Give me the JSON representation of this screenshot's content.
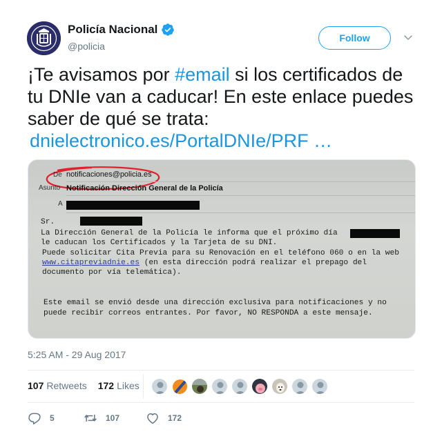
{
  "account": {
    "display_name": "Policía Nacional",
    "handle": "@policia",
    "verified_icon": "verified-badge-icon",
    "follow_label": "Follow"
  },
  "tweet": {
    "text_before": "¡Te avisamos por ",
    "hashtag": "#email",
    "text_after": " si los certificados de tu DNIe van a caducar! En este enlace puedes saber de qué se trata:",
    "link": "dnielectronico.es/PortalDNIe/PRF …",
    "timestamp": "5:25 AM - 29 Aug 2017"
  },
  "photo": {
    "from_label": "De",
    "from_value": "notificaciones@policia.es",
    "subject_label": "Asunto",
    "subject_value": "Notificación Dirección General de la Policía",
    "to_label": "A",
    "body_lines": [
      "Sr.",
      " La Dirección General de la Policía le informa que el próximo día",
      " le caducan los Certificados y la Tarjeta de su DNI.",
      "Puede solicitar Cita Previa para su Renovación en el teléfono 060 o en la web",
      "www.citapreviadnie.es",
      " (en esta dirección podrá realizar el prepago del",
      "documento por vía telemática).",
      "Este email se envió desde una dirección exclusiva para notificaciones y no",
      "puede recibir correos entrantes. Por favor, NO RESPONDA a este mensaje."
    ]
  },
  "stats": {
    "retweets_count": "107",
    "retweets_label": "Retweets",
    "likes_count": "172",
    "likes_label": "Likes"
  },
  "actions": {
    "reply_count": "5",
    "retweet_count": "107",
    "like_count": "172"
  },
  "colors": {
    "accent": "#1da1f2",
    "link": "#1b95e0",
    "muted": "#657786",
    "text": "#14171a"
  }
}
